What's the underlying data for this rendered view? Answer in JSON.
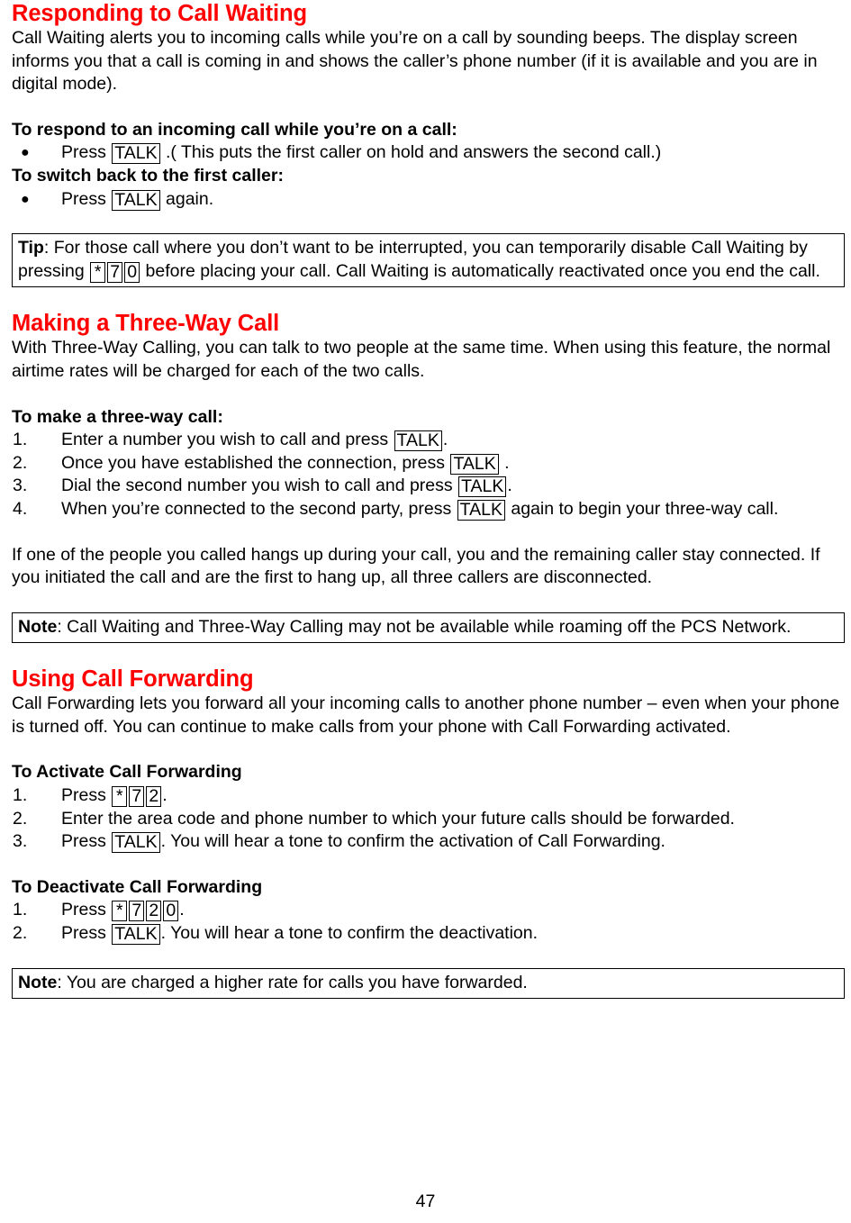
{
  "document": {
    "page_number": "47",
    "accent_color": "#ff0000",
    "text_color": "#000000",
    "background_color": "#ffffff"
  },
  "sections": {
    "call_waiting": {
      "title": "Responding to Call Waiting",
      "intro": "Call Waiting alerts you to incoming calls while you’re on a call by sounding beeps. The display screen informs you that a call is coming in and shows the caller’s phone number (if it is available and you are in digital mode).",
      "respond_heading": "To respond to an incoming call while you’re on a call:",
      "respond_bullet_pre": "Press ",
      "respond_bullet_key": "TALK",
      "respond_bullet_post": " .( This puts the first caller on hold and answers the second call.)",
      "switch_heading": "To switch back to the first caller:",
      "switch_bullet_pre": "Press ",
      "switch_bullet_key": "TALK",
      "switch_bullet_post": " again."
    },
    "tip_box": {
      "label": "Tip",
      "text_1": ": For those call where you don’t want to be interrupted, you can temporarily disable Call Waiting by pressing ",
      "key_1": "*",
      "key_2": "7",
      "key_3": "0",
      "text_2": " before placing your call. Call Waiting is automatically reactivated once you end the call."
    },
    "three_way": {
      "title": "Making a Three-Way Call",
      "intro": "With Three-Way Calling, you can talk to two people at the same time. When using this feature, the normal airtime rates will be charged for each of the two calls.",
      "steps_heading": "To make a three-way call:",
      "steps": [
        {
          "number": "1.",
          "pre": "Enter a number you wish to call and press ",
          "key": "TALK",
          "post": "."
        },
        {
          "number": "2.",
          "pre": "Once you have established the connection, press ",
          "key": "TALK",
          "post": " ."
        },
        {
          "number": "3.",
          "pre": "Dial the second number you wish to call and press ",
          "key": "TALK",
          "post": "."
        },
        {
          "number": "4.",
          "pre": "When you’re connected to the second party, press ",
          "key": "TALK",
          "post": " again to begin your three-way call."
        }
      ],
      "closing": "If one of the people you called hangs up during your call, you and the remaining caller stay connected. If you initiated the call and are the first to hang up, all three callers are disconnected."
    },
    "note_box_1": {
      "label": "Note",
      "text": ": Call Waiting and Three-Way Calling may not be available while roaming off the PCS Network."
    },
    "call_forwarding": {
      "title": "Using Call Forwarding",
      "intro": "Call Forwarding lets you forward all your incoming calls to another phone number – even when your phone is turned off. You can continue to make calls from your phone with Call Forwarding activated.",
      "activate_heading": "To Activate Call Forwarding",
      "activate_steps": [
        {
          "number": "1.",
          "pre": "Press ",
          "keys": [
            "*",
            "7",
            "2"
          ],
          "post": "."
        },
        {
          "number": "2.",
          "pre": "Enter the area code and phone number to which your future calls should be forwarded.",
          "keys": [],
          "post": ""
        },
        {
          "number": "3.",
          "pre": "Press ",
          "keys": [
            "TALK"
          ],
          "post": ". You will hear a tone to confirm the activation of Call Forwarding."
        }
      ],
      "deactivate_heading": "To Deactivate Call Forwarding",
      "deactivate_steps": [
        {
          "number": "1.",
          "pre": "Press ",
          "keys": [
            "*",
            "7",
            "2",
            "0"
          ],
          "post": "."
        },
        {
          "number": "2.",
          "pre": "Press ",
          "keys": [
            "TALK"
          ],
          "post": ". You will hear a tone to confirm the deactivation."
        }
      ]
    },
    "note_box_2": {
      "label": "Note",
      "text": ": You are charged a higher rate for calls you have forwarded."
    }
  }
}
